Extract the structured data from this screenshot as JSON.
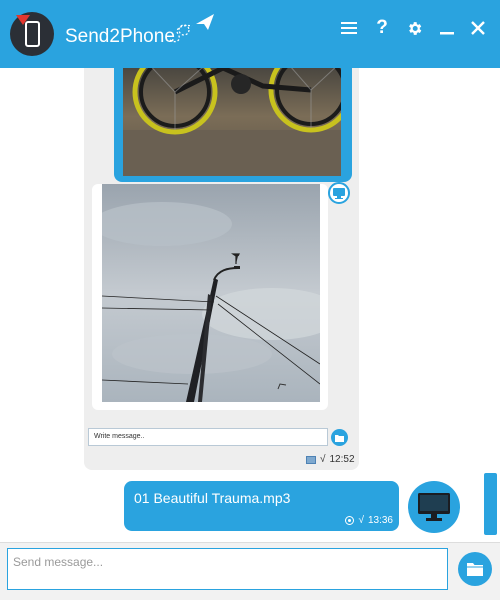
{
  "app": {
    "title": "Send2Phone"
  },
  "header": {
    "icons": [
      "phone-logo-icon",
      "paper-plane-icon",
      "menu-icon",
      "help-icon",
      "settings-icon",
      "minimize-icon",
      "close-icon"
    ],
    "help_label": "?"
  },
  "messages": {
    "received": {
      "embedded_placeholder": "Write message..",
      "time": "12:52",
      "check": "√"
    },
    "sent": {
      "file_name": "01 Beautiful Trauma.mp3",
      "time": "13:36",
      "check": "√"
    }
  },
  "composer": {
    "placeholder": "Send message..."
  },
  "colors": {
    "accent": "#2aa3df",
    "dark": "#2b2f36",
    "bubble_grey": "#eeeeee"
  }
}
